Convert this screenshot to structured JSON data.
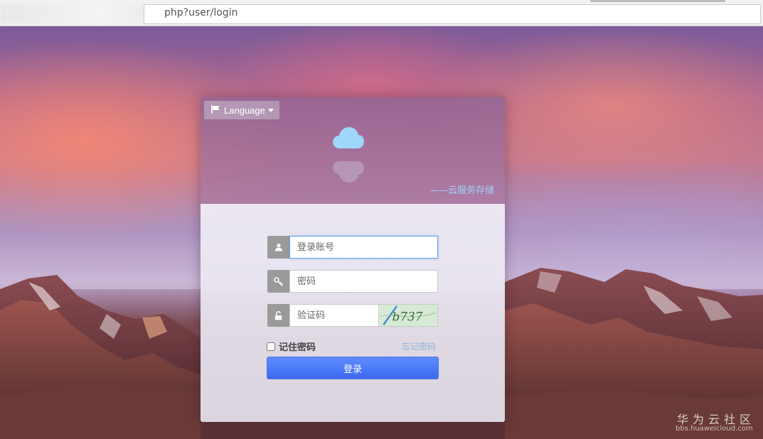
{
  "browser": {
    "url": "php?user/login"
  },
  "login": {
    "language_label": "Language",
    "slogan": "——云服务存储",
    "username_placeholder": "登录账号",
    "password_placeholder": "密码",
    "captcha_placeholder": "验证码",
    "captcha_text": "b737",
    "remember_label": "记住密码",
    "forgot_label": "忘记密码",
    "submit_label": "登录"
  },
  "watermark": {
    "title": "华为云社区",
    "subtitle": "bbs.huaweicloud.com"
  },
  "colors": {
    "accent": "#4a78f5",
    "slogan": "#9fd3f5",
    "cloud": "#9fd6fb"
  },
  "icons": {
    "language": "flag-icon",
    "username": "user-icon",
    "password": "key-icon",
    "captcha": "lock-icon",
    "logo": "cloud-icon"
  }
}
